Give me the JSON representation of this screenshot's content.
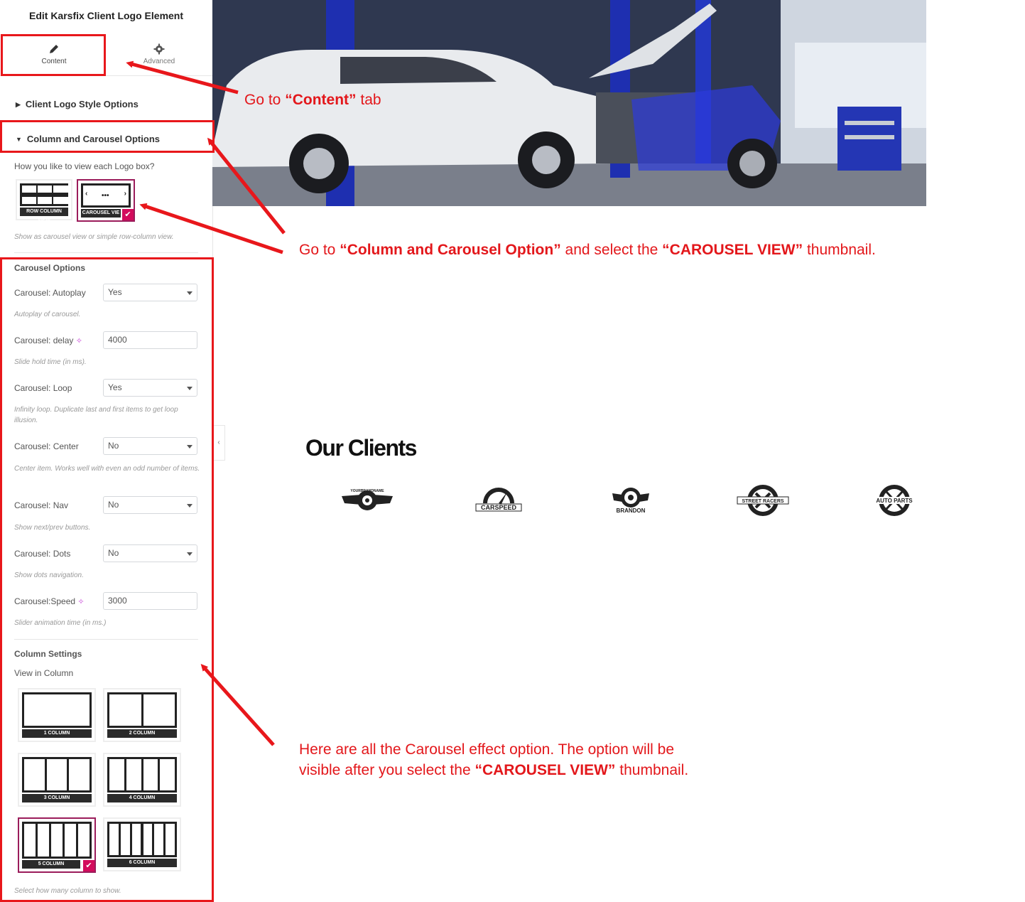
{
  "panel": {
    "title": "Edit Karsfix Client Logo Element",
    "tabs": [
      {
        "label": "Content",
        "icon": "pencil-icon"
      },
      {
        "label": "Advanced",
        "icon": "gear-icon"
      }
    ],
    "sections": [
      {
        "label": "Client Logo Style Options"
      },
      {
        "label": "Column and Carousel Options"
      }
    ],
    "view_question": "How you like to view each Logo box?",
    "view_options": [
      {
        "label": "ROW COLUMN VIEW",
        "selected": false
      },
      {
        "label": "CAROUSEL VIE",
        "selected": true
      }
    ],
    "view_help": "Show as carousel view or simple row-column view.",
    "carousel_heading": "Carousel Options",
    "fields": [
      {
        "label": "Carousel: Autoplay",
        "value": "Yes",
        "type": "select",
        "help": "Autoplay of carousel."
      },
      {
        "label": "Carousel: delay",
        "value": "4000",
        "type": "number",
        "help": "Slide hold time (in ms)."
      },
      {
        "label": "Carousel: Loop",
        "value": "Yes",
        "type": "select",
        "help": "Infinity loop. Duplicate last and first items to get loop illusion."
      },
      {
        "label": "Carousel: Center",
        "value": "No",
        "type": "select",
        "help": "Center item. Works well with even an odd number of items."
      },
      {
        "label": "Carousel: Nav",
        "value": "No",
        "type": "select",
        "help": "Show next/prev buttons."
      },
      {
        "label": "Carousel: Dots",
        "value": "No",
        "type": "select",
        "help": "Show dots navigation."
      },
      {
        "label": "Carousel:Speed",
        "value": "3000",
        "type": "number",
        "help": "Slider animation time (in ms.)"
      }
    ],
    "column_heading": "Column Settings",
    "column_label": "View in Column",
    "columns": [
      {
        "label": "1 COLUMN",
        "n": 1,
        "selected": false
      },
      {
        "label": "2 COLUMN",
        "n": 2,
        "selected": false
      },
      {
        "label": "3 COLUMN",
        "n": 3,
        "selected": false
      },
      {
        "label": "4 COLUMN",
        "n": 4,
        "selected": false
      },
      {
        "label": "5 COLUMN",
        "n": 5,
        "selected": true
      },
      {
        "label": "6 COLUMN",
        "n": 6,
        "selected": false
      }
    ],
    "column_help": "Select how many column to show."
  },
  "preview": {
    "clients_heading": "Our Clients",
    "logos": [
      {
        "name": "YOURBRANDNAME",
        "icon": "tire-wings-logo"
      },
      {
        "name": "CARSPEED",
        "icon": "speedometer-logo"
      },
      {
        "name": "BRANDON",
        "icon": "wheel-wings-logo"
      },
      {
        "name": "STREET RACERS",
        "icon": "wrench-gear-logo"
      },
      {
        "name": "AUTO PARTS",
        "icon": "crossed-wrench-logo"
      }
    ]
  },
  "annotations": {
    "note1_pre": "Go  to ",
    "note1_bold": "“Content”",
    "note1_post": " tab",
    "note2_pre": "Go to ",
    "note2_bold1": "“Column and Carousel Option”",
    "note2_mid": " and select the ",
    "note2_bold2": "“CAROUSEL VIEW”",
    "note2_post": " thumbnail.",
    "note3_line1": "Here are all the Carousel effect option. The option will be",
    "note3_pre": "visible after you select the ",
    "note3_bold": "“CAROUSEL VIEW”",
    "note3_post": " thumbnail."
  },
  "colors": {
    "annotation": "#e8171b",
    "accent": "#d30c5c",
    "selected_border": "#9b1c5b"
  }
}
